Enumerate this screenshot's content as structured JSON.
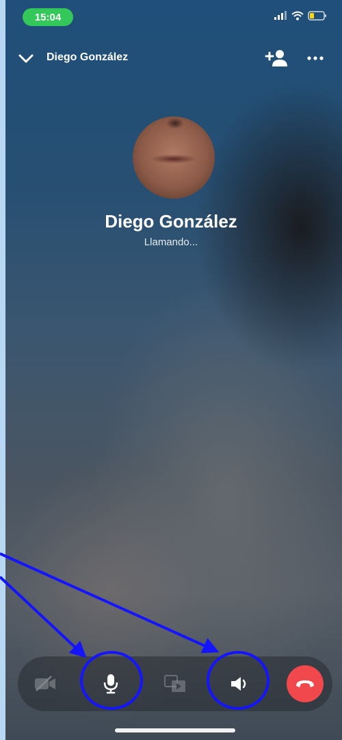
{
  "status_bar": {
    "time": "15:04",
    "icons": [
      "signal-icon",
      "wifi-icon",
      "battery-icon"
    ],
    "time_pill_color": "#34c759"
  },
  "header": {
    "title": "Diego González",
    "icons": [
      "chevron-down-icon",
      "add-person-icon",
      "more-icon"
    ]
  },
  "contact": {
    "name": "Diego González",
    "status": "Llamando..."
  },
  "controls": {
    "buttons": [
      {
        "name": "video-off-button",
        "icon": "video-off-icon",
        "enabled": false
      },
      {
        "name": "mute-button",
        "icon": "microphone-icon",
        "enabled": true
      },
      {
        "name": "screen-share-button",
        "icon": "screen-share-icon",
        "enabled": false
      },
      {
        "name": "speaker-button",
        "icon": "speaker-icon",
        "enabled": true
      },
      {
        "name": "end-call-button",
        "icon": "hang-up-icon",
        "enabled": true
      }
    ],
    "end_call_color": "#f0484d"
  },
  "annotations": {
    "highlight_color": "#1414ff",
    "highlighted": [
      "mute-button",
      "speaker-button"
    ]
  }
}
